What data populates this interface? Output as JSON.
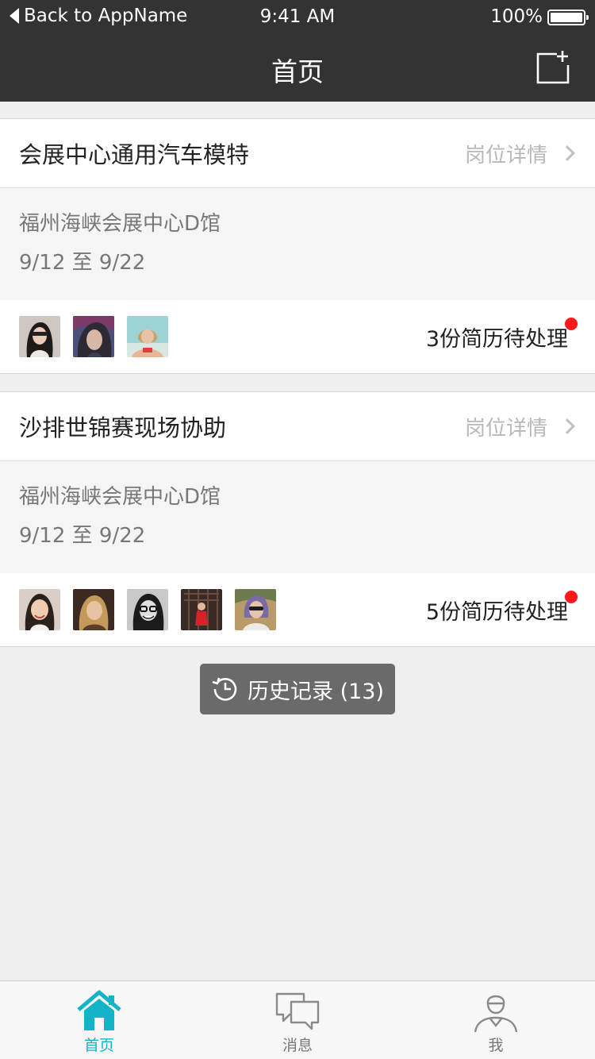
{
  "status_bar": {
    "back_label": "Back to AppName",
    "time": "9:41 AM",
    "battery": "100%"
  },
  "nav": {
    "title": "首页",
    "action_icon": "new-post-icon"
  },
  "jobs": [
    {
      "title": "会展中心通用汽车模特",
      "detail_label": "岗位详情",
      "location": "福州海峡会展中心D馆",
      "date_range": "9/12 至 9/22",
      "pending": "3份简历待处理",
      "avatar_count": 3
    },
    {
      "title": "沙排世锦赛现场协助",
      "detail_label": "岗位详情",
      "location": "福州海峡会展中心D馆",
      "date_range": "9/12 至 9/22",
      "pending": "5份简历待处理",
      "avatar_count": 5
    }
  ],
  "history": {
    "label": "历史记录 (13)"
  },
  "tabbar": {
    "items": [
      {
        "label": "首页",
        "icon": "home-icon",
        "active": true
      },
      {
        "label": "消息",
        "icon": "chat-bubbles-icon",
        "active": false
      },
      {
        "label": "我",
        "icon": "user-profile-icon",
        "active": false
      }
    ]
  },
  "colors": {
    "header_bg": "#333333",
    "accent": "#15b3c8",
    "badge": "#ff1a1a",
    "history_bg": "#6a6a6a"
  }
}
